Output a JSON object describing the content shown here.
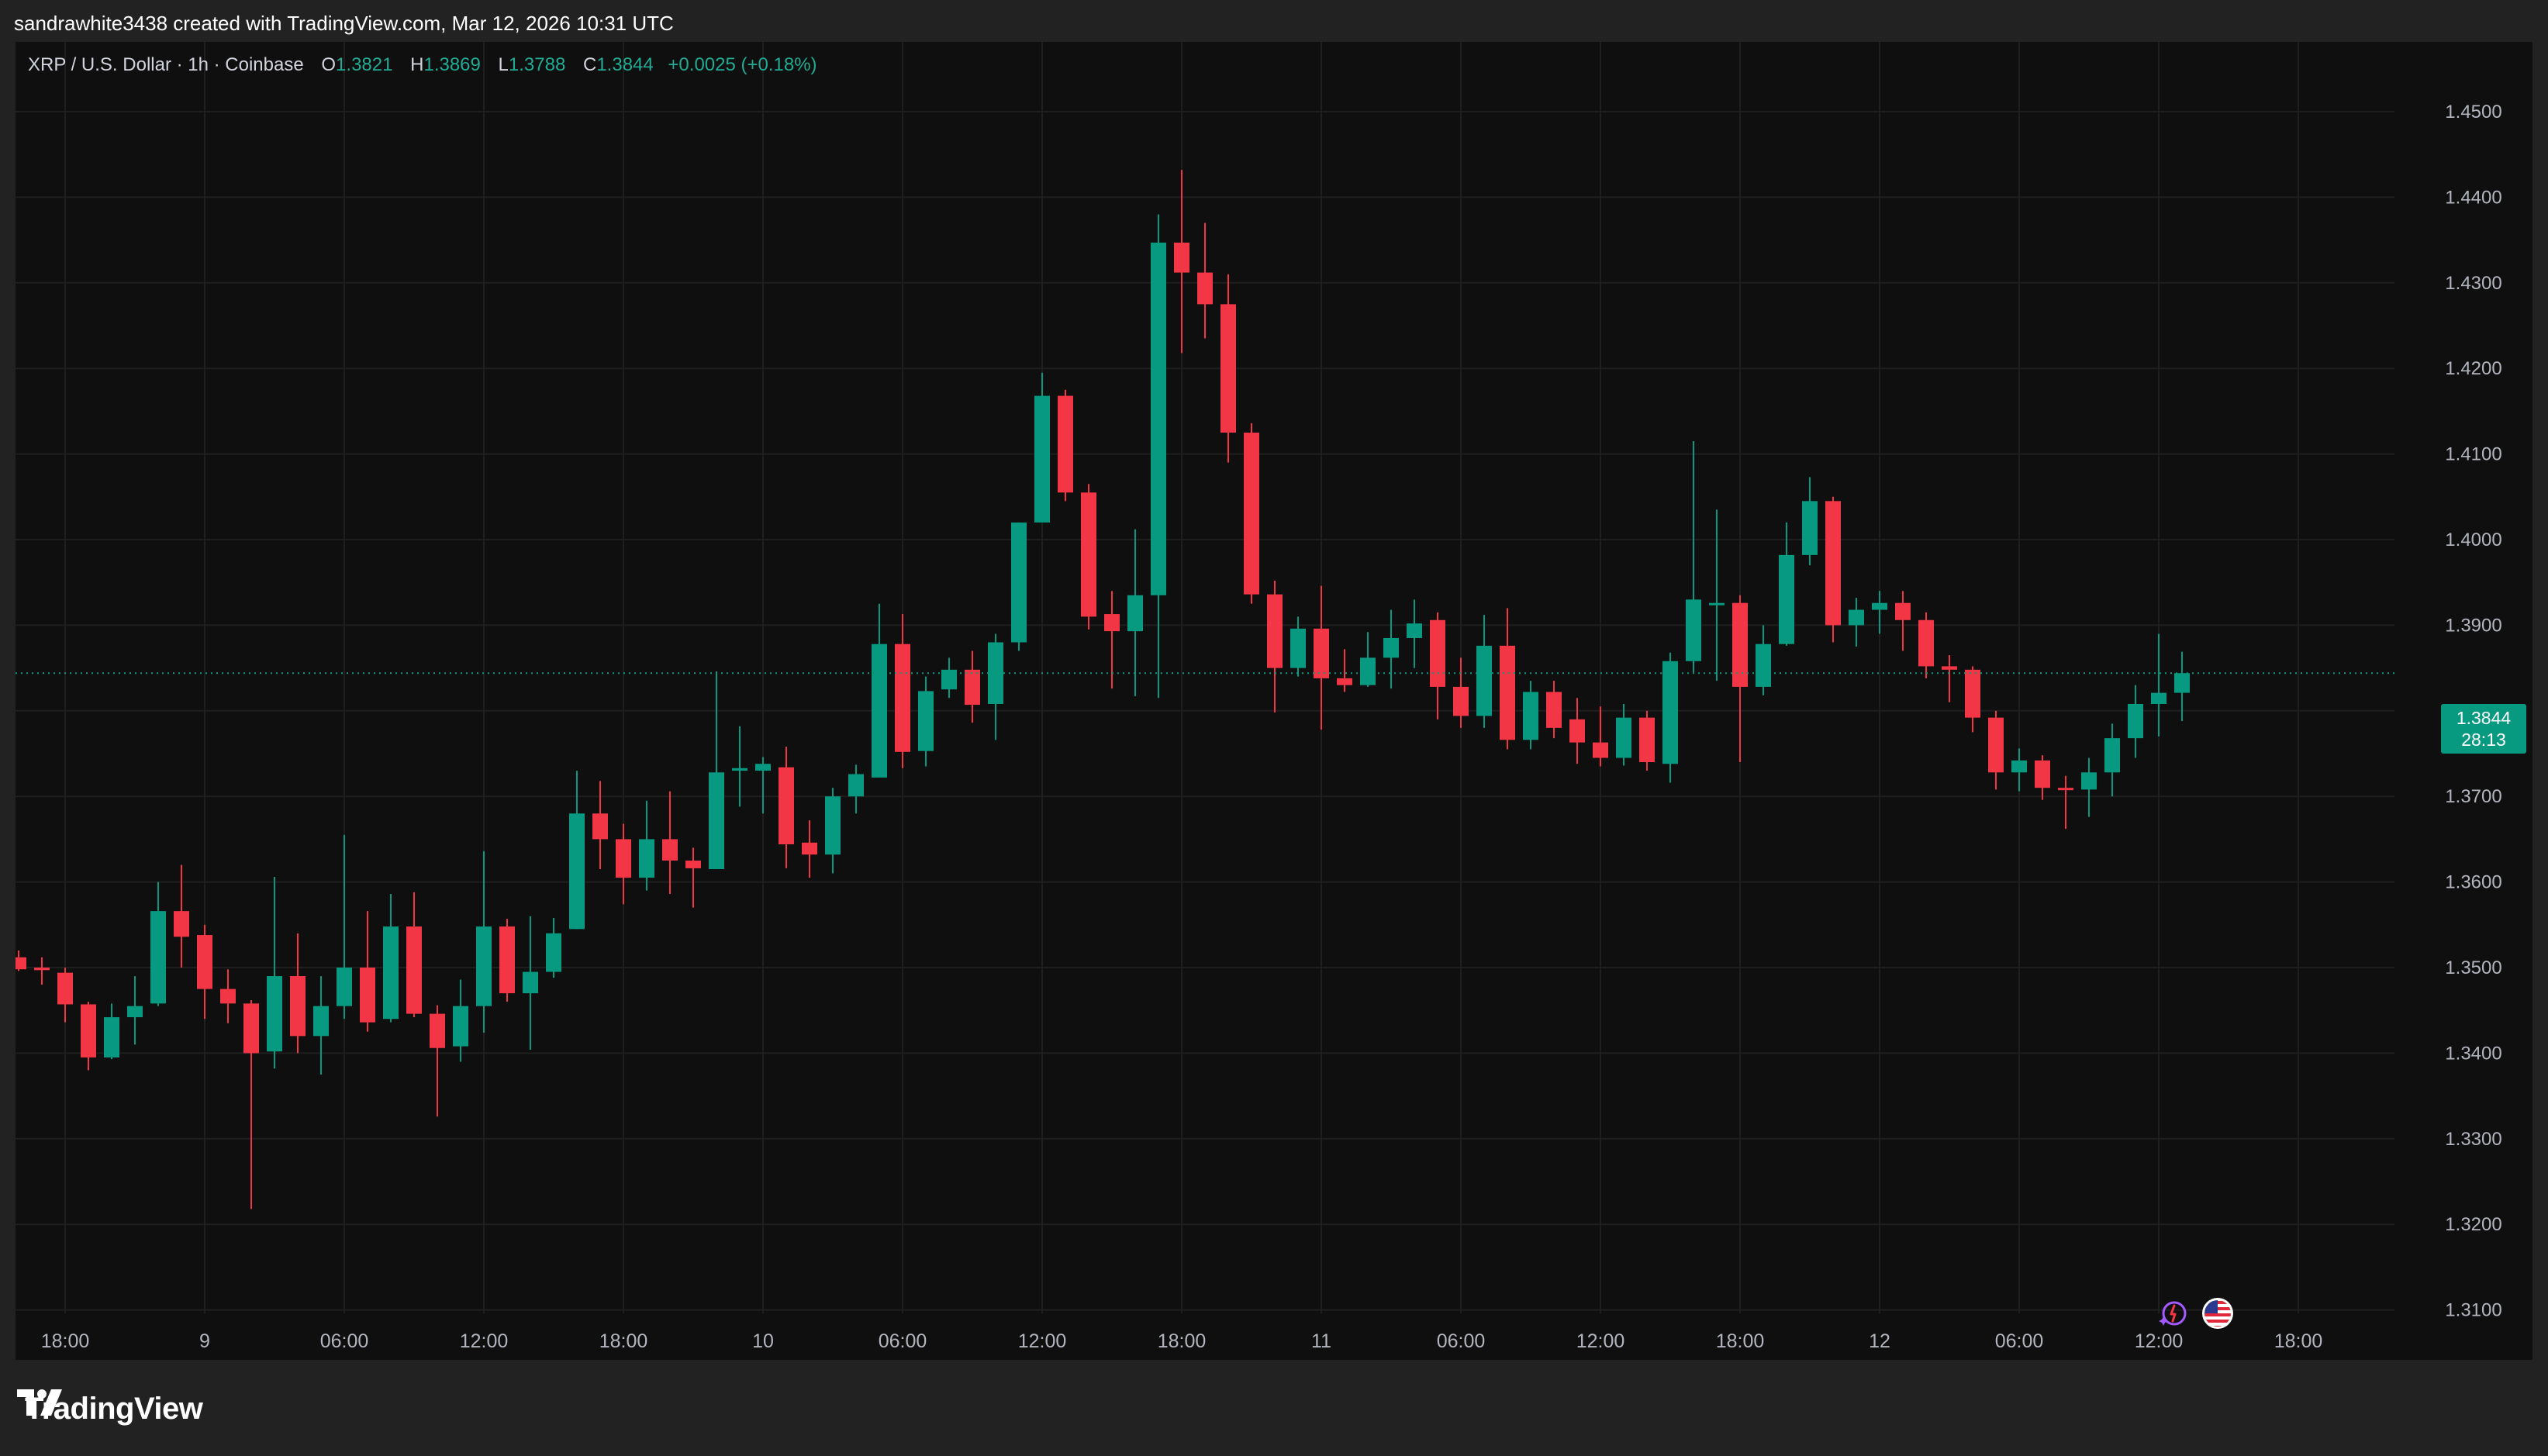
{
  "header": {
    "credit": "sandrawhite3438 created with TradingView.com, Mar 12, 2026 10:31 UTC"
  },
  "legend": {
    "symbol": "XRP / U.S. Dollar · 1h · Coinbase",
    "o_label": "O",
    "o_value": "1.3821",
    "h_label": "H",
    "h_value": "1.3869",
    "l_label": "L",
    "l_value": "1.3788",
    "c_label": "C",
    "c_value": "1.3844",
    "change": "+0.0025 (+0.18%)"
  },
  "last_price": {
    "price": "1.3844",
    "countdown": "28:13"
  },
  "brand": {
    "name": "TradingView"
  },
  "colors": {
    "up": "#089981",
    "down": "#f23645",
    "background": "#0f0f0f",
    "grid": "#1f1f1f",
    "axis_text": "#b2b5be"
  },
  "icons": [
    "tradingview-logo-icon",
    "ai-sparkle-icon",
    "us-flag-icon"
  ],
  "chart_data": {
    "type": "candlestick",
    "interval": "1h",
    "ylim": [
      1.31,
      1.455
    ],
    "y_ticks": [
      "1.4500",
      "1.4400",
      "1.4300",
      "1.4200",
      "1.4100",
      "1.4000",
      "1.3900",
      "1.3800",
      "1.3700",
      "1.3600",
      "1.3500",
      "1.3400",
      "1.3300",
      "1.3200",
      "1.3100"
    ],
    "x_ticks": [
      "18:00",
      "9",
      "06:00",
      "12:00",
      "18:00",
      "10",
      "06:00",
      "12:00",
      "18:00",
      "11",
      "06:00",
      "12:00",
      "18:00",
      "12",
      "06:00",
      "12:00",
      "18:00"
    ],
    "current_price": 1.3844,
    "candles": [
      {
        "o": 1.3512,
        "h": 1.352,
        "l": 1.3496,
        "c": 1.3498
      },
      {
        "o": 1.35,
        "h": 1.3512,
        "l": 1.348,
        "c": 1.3497
      },
      {
        "o": 1.3494,
        "h": 1.35,
        "l": 1.3436,
        "c": 1.3457
      },
      {
        "o": 1.3457,
        "h": 1.346,
        "l": 1.338,
        "c": 1.3395
      },
      {
        "o": 1.3395,
        "h": 1.3458,
        "l": 1.3393,
        "c": 1.3442
      },
      {
        "o": 1.3442,
        "h": 1.349,
        "l": 1.341,
        "c": 1.3455
      },
      {
        "o": 1.3458,
        "h": 1.36,
        "l": 1.3455,
        "c": 1.3566
      },
      {
        "o": 1.3566,
        "h": 1.362,
        "l": 1.35,
        "c": 1.3536
      },
      {
        "o": 1.3538,
        "h": 1.355,
        "l": 1.344,
        "c": 1.3475
      },
      {
        "o": 1.3475,
        "h": 1.3498,
        "l": 1.3435,
        "c": 1.3458
      },
      {
        "o": 1.3458,
        "h": 1.3462,
        "l": 1.3218,
        "c": 1.34
      },
      {
        "o": 1.3402,
        "h": 1.3606,
        "l": 1.3382,
        "c": 1.349
      },
      {
        "o": 1.349,
        "h": 1.354,
        "l": 1.34,
        "c": 1.342
      },
      {
        "o": 1.342,
        "h": 1.349,
        "l": 1.3375,
        "c": 1.3455
      },
      {
        "o": 1.3455,
        "h": 1.3655,
        "l": 1.344,
        "c": 1.35
      },
      {
        "o": 1.35,
        "h": 1.3566,
        "l": 1.3425,
        "c": 1.3436
      },
      {
        "o": 1.344,
        "h": 1.3586,
        "l": 1.3436,
        "c": 1.3548
      },
      {
        "o": 1.3548,
        "h": 1.3588,
        "l": 1.3442,
        "c": 1.3446
      },
      {
        "o": 1.3446,
        "h": 1.3456,
        "l": 1.3326,
        "c": 1.3406
      },
      {
        "o": 1.3408,
        "h": 1.3486,
        "l": 1.339,
        "c": 1.3455
      },
      {
        "o": 1.3455,
        "h": 1.3636,
        "l": 1.3424,
        "c": 1.3548
      },
      {
        "o": 1.3548,
        "h": 1.3557,
        "l": 1.346,
        "c": 1.347
      },
      {
        "o": 1.347,
        "h": 1.356,
        "l": 1.3404,
        "c": 1.3495
      },
      {
        "o": 1.3495,
        "h": 1.3558,
        "l": 1.3488,
        "c": 1.354
      },
      {
        "o": 1.3545,
        "h": 1.373,
        "l": 1.3545,
        "c": 1.368
      },
      {
        "o": 1.368,
        "h": 1.3718,
        "l": 1.3615,
        "c": 1.365
      },
      {
        "o": 1.365,
        "h": 1.3668,
        "l": 1.3574,
        "c": 1.3605
      },
      {
        "o": 1.3605,
        "h": 1.3695,
        "l": 1.359,
        "c": 1.365
      },
      {
        "o": 1.365,
        "h": 1.3706,
        "l": 1.3586,
        "c": 1.3625
      },
      {
        "o": 1.3625,
        "h": 1.364,
        "l": 1.357,
        "c": 1.3616
      },
      {
        "o": 1.3615,
        "h": 1.3846,
        "l": 1.3615,
        "c": 1.3728
      },
      {
        "o": 1.373,
        "h": 1.3782,
        "l": 1.3688,
        "c": 1.3733
      },
      {
        "o": 1.373,
        "h": 1.3746,
        "l": 1.368,
        "c": 1.3738
      },
      {
        "o": 1.3734,
        "h": 1.3758,
        "l": 1.3616,
        "c": 1.3644
      },
      {
        "o": 1.3646,
        "h": 1.3672,
        "l": 1.3605,
        "c": 1.3632
      },
      {
        "o": 1.3632,
        "h": 1.371,
        "l": 1.361,
        "c": 1.37
      },
      {
        "o": 1.37,
        "h": 1.3737,
        "l": 1.368,
        "c": 1.3726
      },
      {
        "o": 1.3722,
        "h": 1.3925,
        "l": 1.3722,
        "c": 1.3878
      },
      {
        "o": 1.3878,
        "h": 1.3913,
        "l": 1.3733,
        "c": 1.3752
      },
      {
        "o": 1.3753,
        "h": 1.384,
        "l": 1.3735,
        "c": 1.3823
      },
      {
        "o": 1.3825,
        "h": 1.3862,
        "l": 1.3815,
        "c": 1.3848
      },
      {
        "o": 1.3848,
        "h": 1.387,
        "l": 1.3786,
        "c": 1.3807
      },
      {
        "o": 1.3808,
        "h": 1.389,
        "l": 1.3766,
        "c": 1.388
      },
      {
        "o": 1.388,
        "h": 1.402,
        "l": 1.387,
        "c": 1.402
      },
      {
        "o": 1.402,
        "h": 1.4195,
        "l": 1.402,
        "c": 1.4168
      },
      {
        "o": 1.4168,
        "h": 1.4175,
        "l": 1.4045,
        "c": 1.4055
      },
      {
        "o": 1.4055,
        "h": 1.4065,
        "l": 1.3895,
        "c": 1.391
      },
      {
        "o": 1.3913,
        "h": 1.394,
        "l": 1.3826,
        "c": 1.3893
      },
      {
        "o": 1.3893,
        "h": 1.4012,
        "l": 1.3817,
        "c": 1.3935
      },
      {
        "o": 1.3935,
        "h": 1.438,
        "l": 1.3815,
        "c": 1.4347
      },
      {
        "o": 1.4347,
        "h": 1.4432,
        "l": 1.4218,
        "c": 1.4312
      },
      {
        "o": 1.4312,
        "h": 1.437,
        "l": 1.4235,
        "c": 1.4275
      },
      {
        "o": 1.4275,
        "h": 1.431,
        "l": 1.409,
        "c": 1.4125
      },
      {
        "o": 1.4125,
        "h": 1.4136,
        "l": 1.3925,
        "c": 1.3936
      },
      {
        "o": 1.3936,
        "h": 1.3952,
        "l": 1.3798,
        "c": 1.385
      },
      {
        "o": 1.385,
        "h": 1.391,
        "l": 1.384,
        "c": 1.3896
      },
      {
        "o": 1.3896,
        "h": 1.3946,
        "l": 1.3778,
        "c": 1.3838
      },
      {
        "o": 1.3838,
        "h": 1.3872,
        "l": 1.3822,
        "c": 1.383
      },
      {
        "o": 1.383,
        "h": 1.3892,
        "l": 1.3828,
        "c": 1.3862
      },
      {
        "o": 1.3862,
        "h": 1.3918,
        "l": 1.3826,
        "c": 1.3885
      },
      {
        "o": 1.3885,
        "h": 1.393,
        "l": 1.385,
        "c": 1.3902
      },
      {
        "o": 1.3906,
        "h": 1.3915,
        "l": 1.379,
        "c": 1.3828
      },
      {
        "o": 1.3828,
        "h": 1.3862,
        "l": 1.378,
        "c": 1.3794
      },
      {
        "o": 1.3794,
        "h": 1.3912,
        "l": 1.378,
        "c": 1.3876
      },
      {
        "o": 1.3876,
        "h": 1.392,
        "l": 1.3755,
        "c": 1.3766
      },
      {
        "o": 1.3766,
        "h": 1.3835,
        "l": 1.3755,
        "c": 1.3822
      },
      {
        "o": 1.3822,
        "h": 1.3835,
        "l": 1.3768,
        "c": 1.378
      },
      {
        "o": 1.379,
        "h": 1.3815,
        "l": 1.3738,
        "c": 1.3763
      },
      {
        "o": 1.3763,
        "h": 1.3805,
        "l": 1.3735,
        "c": 1.3745
      },
      {
        "o": 1.3745,
        "h": 1.3808,
        "l": 1.3736,
        "c": 1.3792
      },
      {
        "o": 1.3792,
        "h": 1.38,
        "l": 1.373,
        "c": 1.374
      },
      {
        "o": 1.3738,
        "h": 1.3868,
        "l": 1.3716,
        "c": 1.3858
      },
      {
        "o": 1.3858,
        "h": 1.4115,
        "l": 1.3845,
        "c": 1.393
      },
      {
        "o": 1.3926,
        "h": 1.4035,
        "l": 1.3835,
        "c": 1.3926
      },
      {
        "o": 1.3926,
        "h": 1.3935,
        "l": 1.374,
        "c": 1.3828
      },
      {
        "o": 1.3828,
        "h": 1.39,
        "l": 1.3818,
        "c": 1.3878
      },
      {
        "o": 1.3878,
        "h": 1.402,
        "l": 1.3876,
        "c": 1.3982
      },
      {
        "o": 1.3982,
        "h": 1.4073,
        "l": 1.397,
        "c": 1.4045
      },
      {
        "o": 1.4045,
        "h": 1.405,
        "l": 1.388,
        "c": 1.39
      },
      {
        "o": 1.39,
        "h": 1.3932,
        "l": 1.3875,
        "c": 1.3918
      },
      {
        "o": 1.3918,
        "h": 1.394,
        "l": 1.389,
        "c": 1.3926
      },
      {
        "o": 1.3926,
        "h": 1.394,
        "l": 1.387,
        "c": 1.3906
      },
      {
        "o": 1.3906,
        "h": 1.3915,
        "l": 1.3838,
        "c": 1.3852
      },
      {
        "o": 1.3852,
        "h": 1.3865,
        "l": 1.381,
        "c": 1.3848
      },
      {
        "o": 1.3848,
        "h": 1.3852,
        "l": 1.3775,
        "c": 1.3792
      },
      {
        "o": 1.3792,
        "h": 1.38,
        "l": 1.3708,
        "c": 1.3728
      },
      {
        "o": 1.3728,
        "h": 1.3756,
        "l": 1.3706,
        "c": 1.3742
      },
      {
        "o": 1.3742,
        "h": 1.3748,
        "l": 1.3696,
        "c": 1.371
      },
      {
        "o": 1.371,
        "h": 1.3724,
        "l": 1.3662,
        "c": 1.3708
      },
      {
        "o": 1.3708,
        "h": 1.3745,
        "l": 1.3676,
        "c": 1.3728
      },
      {
        "o": 1.3728,
        "h": 1.3785,
        "l": 1.37,
        "c": 1.3768
      },
      {
        "o": 1.3768,
        "h": 1.383,
        "l": 1.3745,
        "c": 1.3808
      },
      {
        "o": 1.3808,
        "h": 1.389,
        "l": 1.377,
        "c": 1.3821
      },
      {
        "o": 1.3821,
        "h": 1.3869,
        "l": 1.3788,
        "c": 1.3844
      }
    ]
  }
}
